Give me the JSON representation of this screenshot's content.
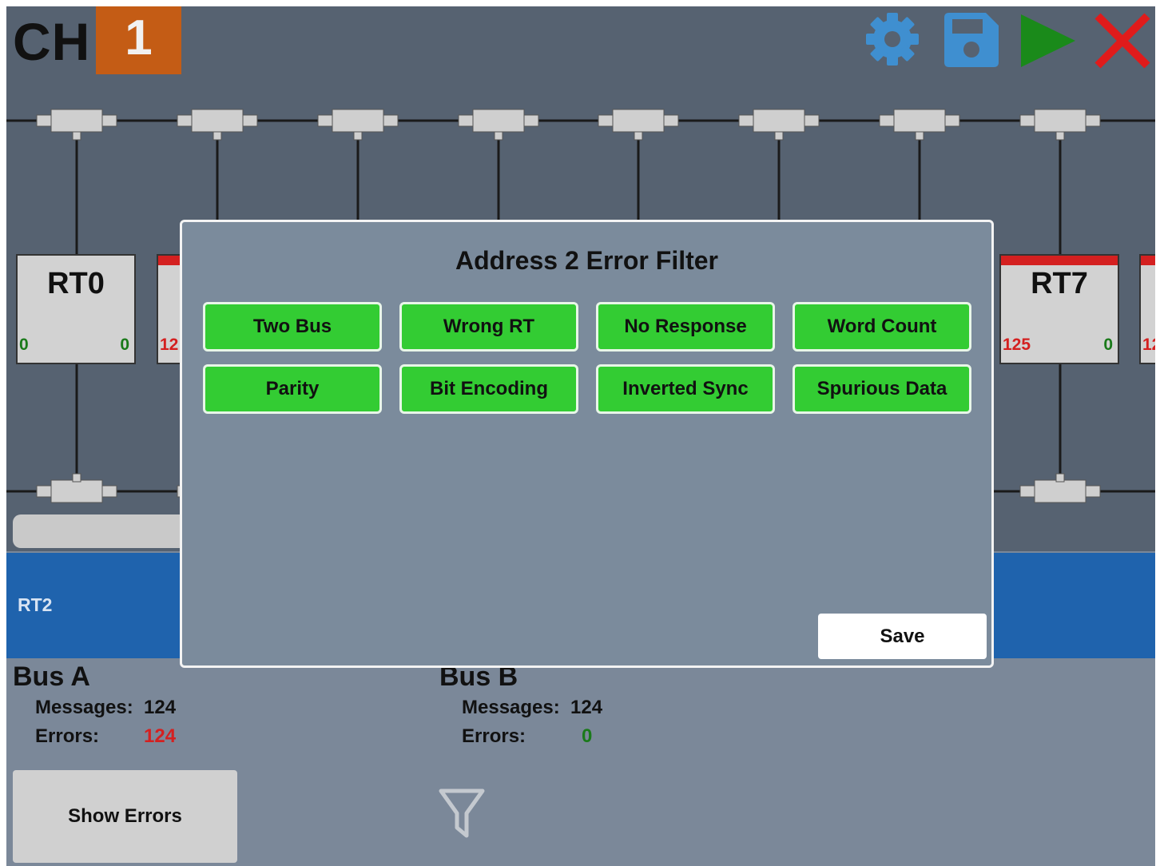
{
  "header": {
    "channel_label": "CH",
    "channel_number": "1",
    "icons": [
      "gear-icon",
      "save-disk-icon",
      "play-icon",
      "close-icon"
    ],
    "colors": {
      "channel_badge": "#c45c15",
      "gear": "#3f8fd0",
      "save": "#3f8fd0",
      "play": "#1a8a1a",
      "close": "#e01b1b"
    }
  },
  "rts": {
    "rt0": {
      "name": "RT0",
      "left_count": "0",
      "right_count": "0"
    },
    "rt1_partial": {
      "left_count": "12"
    },
    "rt7": {
      "name": "RT7",
      "left_count": "125",
      "right_count": "0"
    },
    "rt8_partial": {
      "left_count": "12"
    }
  },
  "selected_rt": "RT2",
  "bus_a": {
    "title": "Bus A",
    "messages_label": "Messages:",
    "messages": "124",
    "errors_label": "Errors:",
    "errors": "124"
  },
  "bus_b": {
    "title": "Bus B",
    "messages_label": "Messages:",
    "messages": "124",
    "errors_label": "Errors:",
    "errors": "0"
  },
  "show_errors_label": "Show Errors",
  "dialog": {
    "title": "Address 2 Error Filter",
    "filters": [
      "Two Bus",
      "Wrong RT",
      "No Response",
      "Word Count",
      "Parity",
      "Bit Encoding",
      "Inverted Sync",
      "Spurious Data"
    ],
    "save_label": "Save",
    "colors": {
      "filter_active": "#33cc33"
    }
  }
}
